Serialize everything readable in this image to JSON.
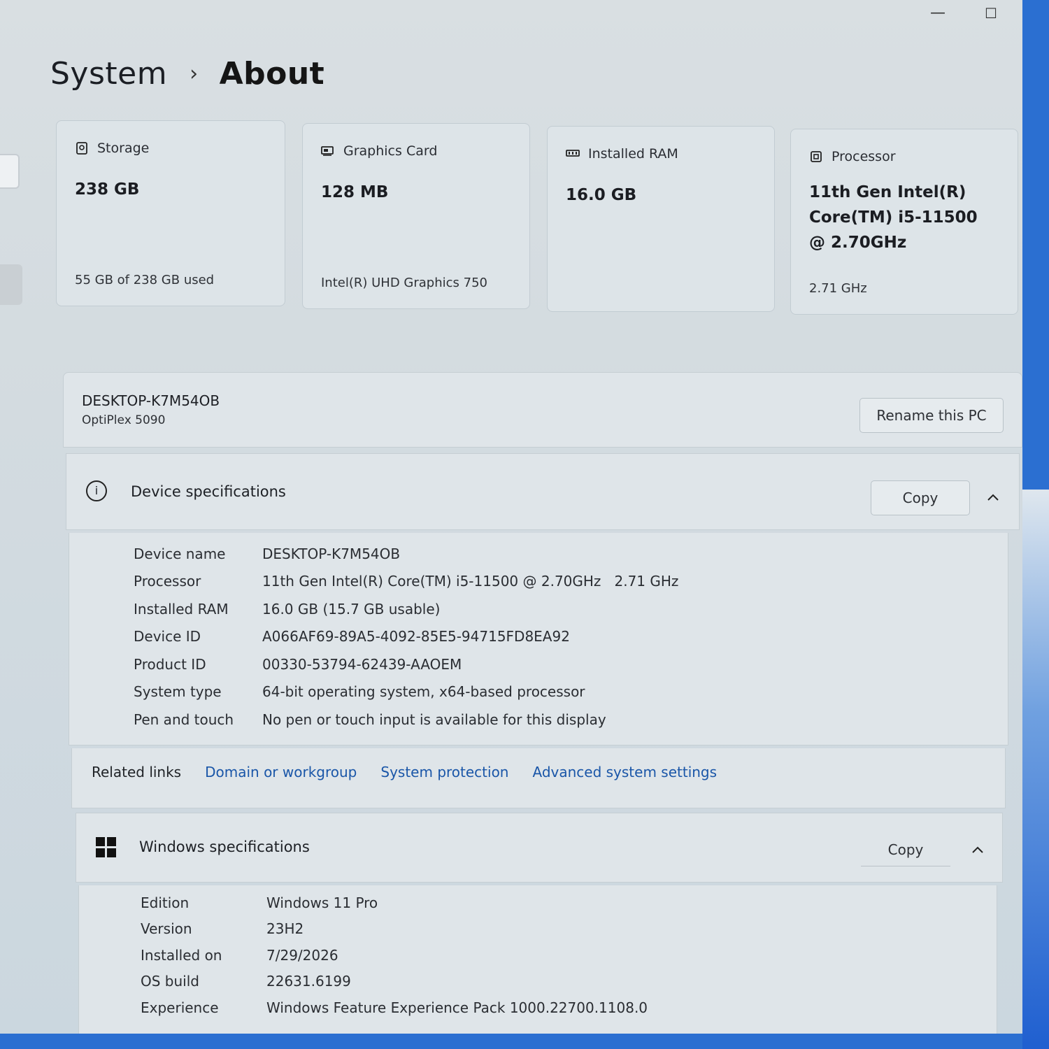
{
  "window": {
    "minimize_glyph": "—",
    "maximize_glyph": "☐",
    "close_glyph": "✕"
  },
  "breadcrumb": {
    "parent": "System",
    "separator": "›",
    "current": "About"
  },
  "cards": [
    {
      "icon": "storage-icon",
      "title": "Storage",
      "value": "238 GB",
      "sub": "55 GB of 238 GB used"
    },
    {
      "icon": "graphics-card-icon",
      "title": "Graphics Card",
      "value": "128 MB",
      "sub": "Intel(R) UHD Graphics 750"
    },
    {
      "icon": "ram-icon",
      "title": "Installed RAM",
      "value": "16.0 GB",
      "sub": ""
    },
    {
      "icon": "processor-icon",
      "title": "Processor",
      "value": "11th Gen Intel(R) Core(TM) i5-11500 @ 2.70GHz",
      "sub": "2.71 GHz"
    }
  ],
  "pc": {
    "name": "DESKTOP-K7M54OB",
    "model": "OptiPlex 5090",
    "rename_label": "Rename this PC"
  },
  "device_specs": {
    "title": "Device specifications",
    "copy_label": "Copy",
    "rows": [
      {
        "key": "Device name",
        "value": "DESKTOP-K7M54OB"
      },
      {
        "key": "Processor",
        "value": "11th Gen Intel(R) Core(TM) i5-11500 @ 2.70GHz   2.71 GHz"
      },
      {
        "key": "Installed RAM",
        "value": "16.0 GB (15.7 GB usable)"
      },
      {
        "key": "Device ID",
        "value": "A066AF69-89A5-4092-85E5-94715FD8EA92"
      },
      {
        "key": "Product ID",
        "value": "00330-53794-62439-AAOEM"
      },
      {
        "key": "System type",
        "value": "64-bit operating system, x64-based processor"
      },
      {
        "key": "Pen and touch",
        "value": "No pen or touch input is available for this display"
      }
    ]
  },
  "related_links": {
    "label": "Related links",
    "links": [
      "Domain or workgroup",
      "System protection",
      "Advanced system settings"
    ]
  },
  "windows_specs": {
    "title": "Windows specifications",
    "copy_label": "Copy",
    "rows": [
      {
        "key": "Edition",
        "value": "Windows 11 Pro"
      },
      {
        "key": "Version",
        "value": "23H2"
      },
      {
        "key": "Installed on",
        "value": "7/29/2026"
      },
      {
        "key": "OS build",
        "value": "22631.6199"
      },
      {
        "key": "Experience",
        "value": "Windows Feature Experience Pack 1000.22700.1108.0"
      }
    ]
  }
}
